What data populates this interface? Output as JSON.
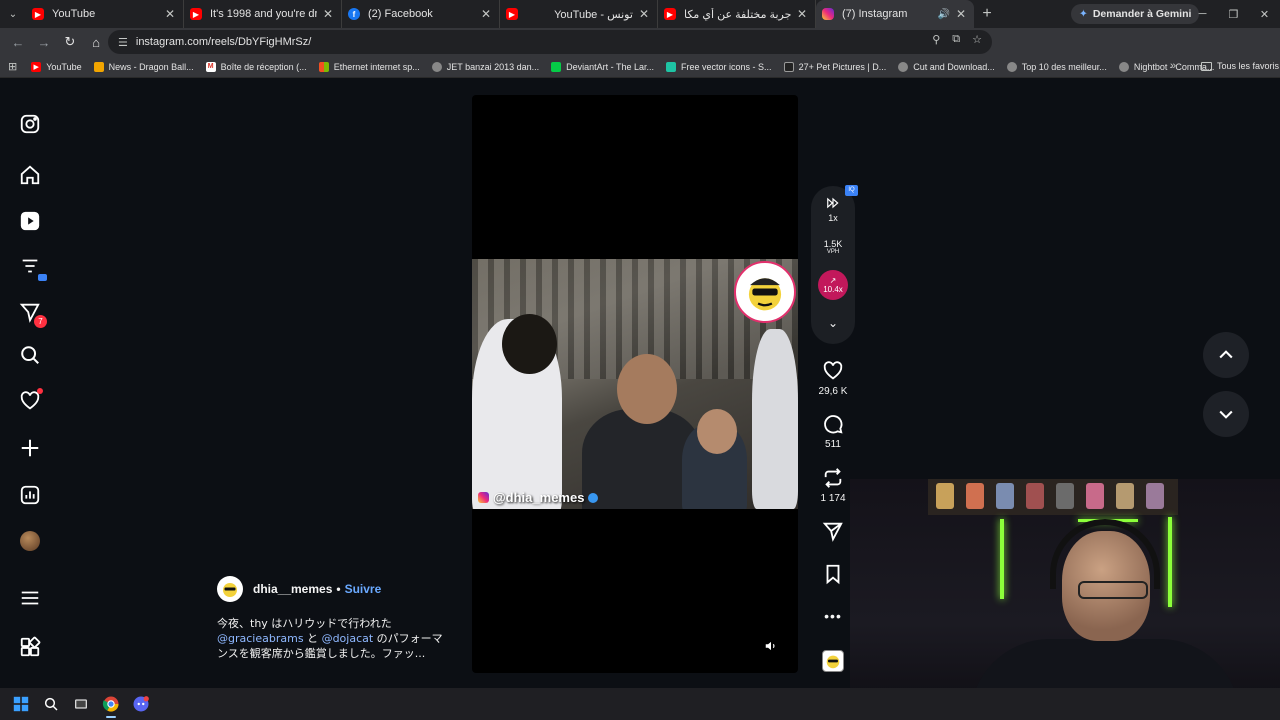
{
  "browser": {
    "tabs": [
      {
        "title": "YouTube",
        "type": "yt"
      },
      {
        "title": "It's 1998 and you're drifting in t",
        "type": "yt"
      },
      {
        "title": "(2) Facebook",
        "type": "fb"
      },
      {
        "title": "YouTube - تونس",
        "type": "yt"
      },
      {
        "title": "ليه جزيرة جربة مختلفة عن أي مكا",
        "type": "yt"
      },
      {
        "title": "(7) Instagram",
        "type": "ig"
      }
    ],
    "gemini_label": "Demander à Gemini",
    "url": "instagram.com/reels/DbYFigHMrSz/",
    "bookmarks": [
      "YouTube",
      "News - Dragon Ball...",
      "Boîte de réception (...",
      "Ethernet internet sp...",
      "JET banzai 2013 dan...",
      "DeviantArt - The Lar...",
      "Free vector icons - S...",
      "27+ Pet Pictures | D...",
      "Cut and Download...",
      "Top 10 des meilleur...",
      "Nightbot - Comma..."
    ],
    "all_bookmarks_label": "Tous les favoris"
  },
  "instagram": {
    "sidebar": {
      "notifications_badge": "7"
    },
    "reel": {
      "watermark": "@dhia_memes"
    },
    "caption": {
      "username": "dhia__memes",
      "separator": "•",
      "follow_label": "Suivre",
      "line1": "今夜、thy はハリウッドで行われた",
      "mention1": "@gracieabrams",
      "and": " と ",
      "mention2": "@dojacat",
      "line2_suffix": " のパフォーマ",
      "line3": "ンスを観客席から鑑賞しました。ファッ..."
    },
    "stats_pill": {
      "speed": "1x",
      "vph": "1.5K",
      "vph_label": "VPH",
      "multiplier": "10.4x"
    },
    "actions": {
      "likes": "29,6 K",
      "comments": "511",
      "reposts": "1 174"
    }
  },
  "colors": {
    "accent_follow": "#6aa9ff",
    "notification_badge": "#ff3040",
    "boost": "#c2185b"
  }
}
